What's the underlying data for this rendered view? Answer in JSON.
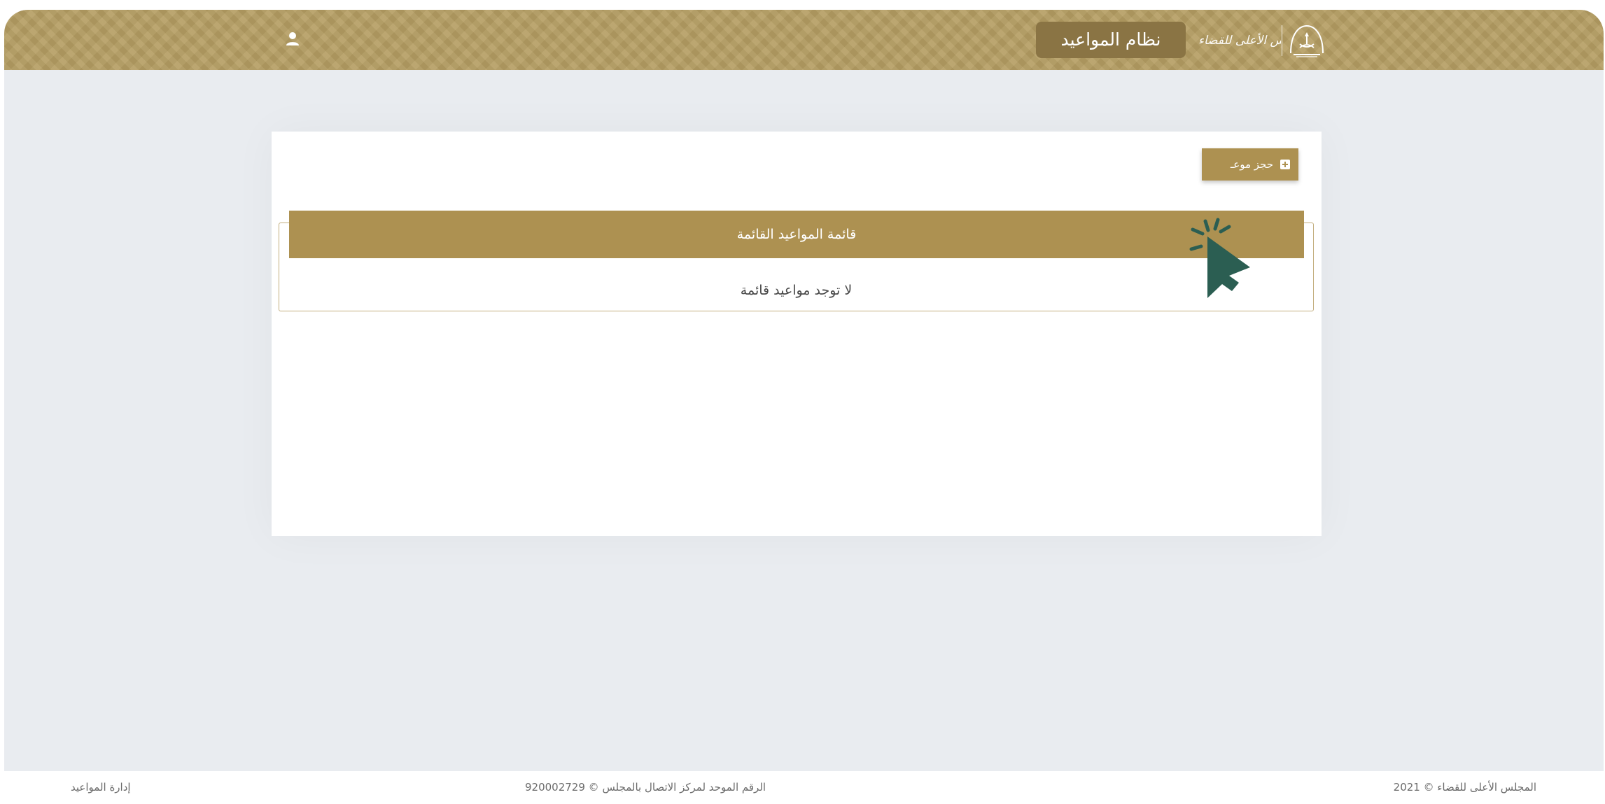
{
  "header": {
    "system_title": "نظام المواعيد",
    "logo_text": "المجلس الأعلى للقضاء",
    "colors": {
      "header_bg": "#b59e63",
      "title_pill_bg": "#8a7444"
    },
    "icons": {
      "user": "user-icon",
      "emblem": "saudi-emblem-icon"
    }
  },
  "card": {
    "book_button_label": "حجز موعـ",
    "book_button_icon": "plus-square-icon",
    "list_title": "قائمة المواعيد القائمة",
    "empty_message": "لا توجد مواعيد قائمة",
    "accent_color": "#ad9151"
  },
  "footer": {
    "left": "إدارة المواعيد",
    "center": "920002729 © الرقم الموحد لمركز الاتصال بالمجلس",
    "right": "2021 © المجلس الأعلى للقضاء"
  },
  "overlay": {
    "pointer_icon": "hand-pointer-cursor-icon",
    "pointer_color": "#2b5e52"
  }
}
